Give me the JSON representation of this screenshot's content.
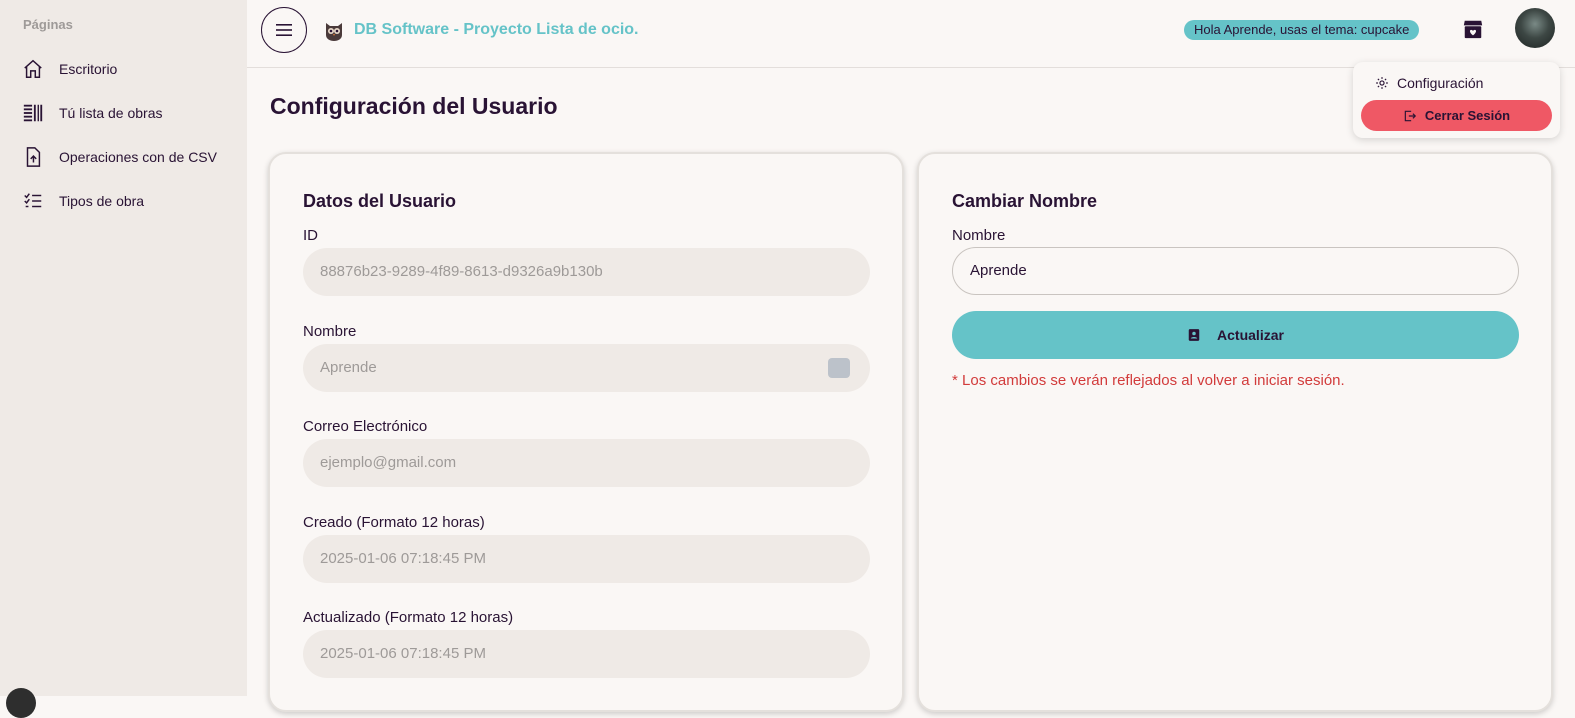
{
  "sidebar": {
    "title": "Páginas",
    "items": [
      {
        "label": "Escritorio",
        "icon": "home-icon"
      },
      {
        "label": "Tú lista de obras",
        "icon": "list-columns-icon"
      },
      {
        "label": "Operaciones con de CSV",
        "icon": "file-upload-icon"
      },
      {
        "label": "Tipos de obra",
        "icon": "checklist-icon"
      }
    ]
  },
  "header": {
    "app_title": "DB Software - Proyecto Lista de ocio.",
    "greeting": "Hola Aprende, usas el tema: cupcake",
    "menu_icon": "hamburger-icon",
    "logo_icon": "owl-logo-icon",
    "shop_icon": "store-icon"
  },
  "dropdown": {
    "settings_label": "Configuración",
    "logout_label": "Cerrar Sesión"
  },
  "page": {
    "title": "Configuración del Usuario"
  },
  "user_card": {
    "title": "Datos del Usuario",
    "fields": [
      {
        "label": "ID",
        "value": "88876b23-9289-4f89-8613-d9326a9b130b"
      },
      {
        "label": "Nombre",
        "value": "Aprende"
      },
      {
        "label": "Correo Electrónico",
        "value": "ejemplo@gmail.com"
      },
      {
        "label": "Creado (Formato 12 horas)",
        "value": "2025-01-06 07:18:45 PM"
      },
      {
        "label": "Actualizado (Formato 12 horas)",
        "value": "2025-01-06 07:18:45 PM"
      }
    ]
  },
  "rename_card": {
    "title": "Cambiar Nombre",
    "name_label": "Nombre",
    "name_value": "Aprende",
    "button_label": "Actualizar",
    "note": "* Los cambios se verán reflejados al volver a iniciar sesión."
  },
  "colors": {
    "accent": "#65c3c8",
    "danger": "#ef5865",
    "text": "#291334",
    "sidebar_bg": "#efeae6"
  }
}
